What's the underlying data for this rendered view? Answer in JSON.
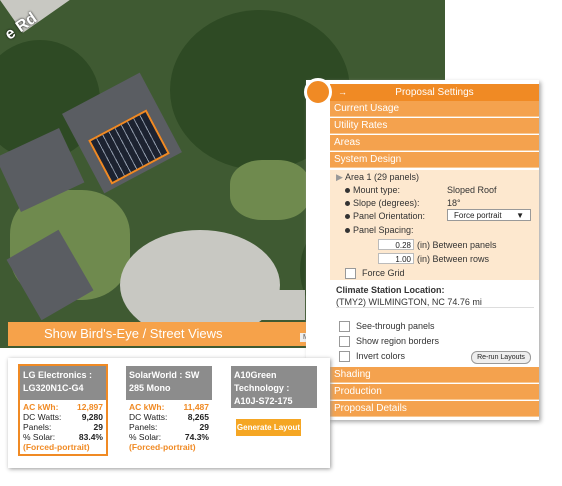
{
  "map": {
    "road_label": "e Rd",
    "birds_eye_label": "Show Bird's-Eye / Street Views",
    "map_data": "Map dat"
  },
  "panel": {
    "title": "Proposal Settings",
    "sections_top": [
      "Current Usage",
      "Utility Rates",
      "Areas",
      "System Design"
    ],
    "area_label": "Area 1 (29 panels)",
    "mount_label": "Mount type:",
    "mount_value": "Sloped Roof",
    "slope_label": "Slope (degrees):",
    "slope_value": "18°",
    "orient_label": "Panel Orientation:",
    "orient_value": "Force portrait",
    "spacing_label": "Panel Spacing:",
    "between_panels_value": "0.28",
    "between_panels_label": "(in) Between panels",
    "between_rows_value": "1.00",
    "between_rows_label": "(in) Between rows",
    "force_grid": "Force Grid",
    "climate_label": "Climate Station Location:",
    "climate_value": "(TMY2) WILMINGTON, NC 74.76 mi",
    "see_through": "See-through panels",
    "region_borders": "Show region borders",
    "invert_colors": "Invert colors",
    "rerun": "Re-run Layouts",
    "sections_bottom": [
      "Shading",
      "Production",
      "Proposal Details"
    ]
  },
  "cards": [
    {
      "header": "LG Electronics : LG320N1C-G4",
      "ac_label": "AC kWh:",
      "ac_value": "12,897",
      "dc_label": "DC Watts:",
      "dc_value": "9,280",
      "panels_label": "Panels:",
      "panels_value": "29",
      "solar_label": "% Solar:",
      "solar_value": "83.4%",
      "note": "(Forced-portrait)"
    },
    {
      "header": "SolarWorld : SW 285 Mono",
      "ac_label": "AC kWh:",
      "ac_value": "11,487",
      "dc_label": "DC Watts:",
      "dc_value": "8,265",
      "panels_label": "Panels:",
      "panels_value": "29",
      "solar_label": "% Solar:",
      "solar_value": "74.3%",
      "note": "(Forced-portrait)"
    },
    {
      "header": "A10Green Technology : A10J-S72-175",
      "button": "Generate Layout"
    }
  ],
  "colors": {
    "accent": "#f08a24",
    "section": "#f4a24e",
    "design_bg": "#fde8cf",
    "card_header": "#8c8c8c"
  }
}
